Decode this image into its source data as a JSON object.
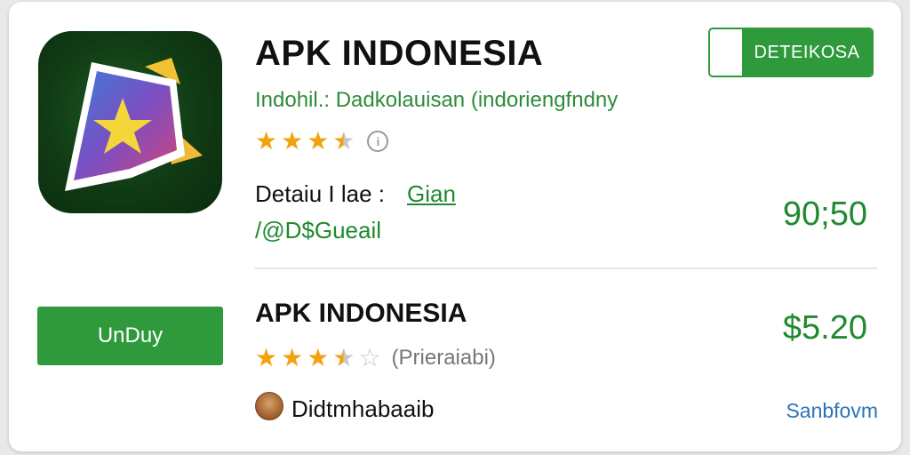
{
  "colors": {
    "accent_green": "#2f9a3c",
    "text_green": "#1f8a30",
    "star_gold": "#f2a20d",
    "link_blue": "#2a73b8"
  },
  "app": {
    "icon": "app-logo-icon",
    "title": "APK INDONESIA",
    "subtitle": "Indohil.: Dadkolauisan (indoriengfndny",
    "rating_stars": 3.5,
    "info_icon": "info-icon",
    "detail_label": "Detaiu I lae :",
    "detail_link": "Gian",
    "detail_value": "/@D$Gueail",
    "price": "90;50",
    "detail_button": "DETEIKOSA"
  },
  "listing": {
    "download_button": "UnDuy",
    "title": "APK INDONESIA",
    "rating_stars": 3.5,
    "rating_text": "(Prieraiabi)",
    "price": "$5.20",
    "author": "Didtmhabaaib",
    "platform_link": "Sanbfovm"
  }
}
